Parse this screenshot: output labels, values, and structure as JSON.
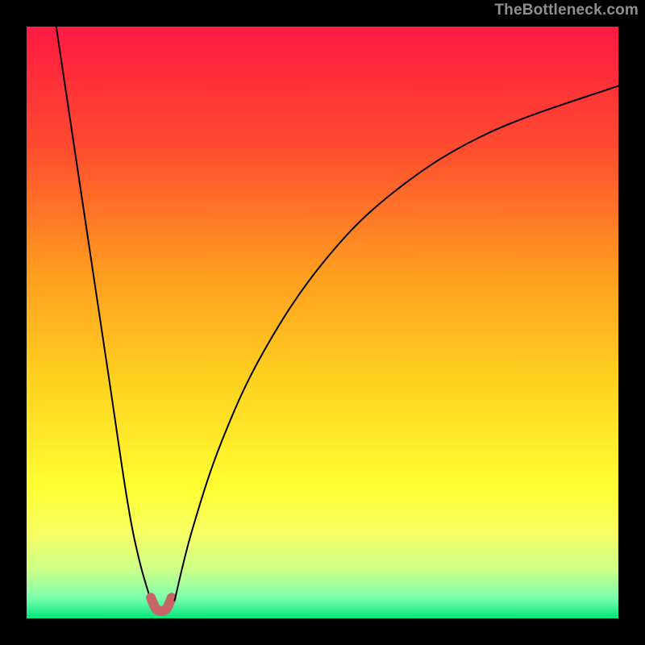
{
  "watermark": "TheBottleneck.com",
  "chart_data": {
    "type": "line",
    "title": "",
    "xlabel": "",
    "ylabel": "",
    "xlim": [
      0,
      100
    ],
    "ylim": [
      0,
      100
    ],
    "gradient_stops": [
      {
        "offset": 0,
        "color": "#ff1a42"
      },
      {
        "offset": 0.2,
        "color": "#ff4a2f"
      },
      {
        "offset": 0.42,
        "color": "#ff9e1f"
      },
      {
        "offset": 0.6,
        "color": "#ffd21f"
      },
      {
        "offset": 0.78,
        "color": "#ffff33"
      },
      {
        "offset": 0.86,
        "color": "#f6ff65"
      },
      {
        "offset": 0.92,
        "color": "#c9ff8a"
      },
      {
        "offset": 0.965,
        "color": "#7dffad"
      },
      {
        "offset": 1.0,
        "color": "#00e57a"
      }
    ],
    "good_zone_band": {
      "y_bottom": 0,
      "y_top": 3,
      "color": "#00e57a"
    },
    "series": [
      {
        "name": "left-branch",
        "type": "curve",
        "stroke": "#000000",
        "stroke_width": 2,
        "points": [
          {
            "x": 5,
            "y": 100
          },
          {
            "x": 8,
            "y": 80
          },
          {
            "x": 11,
            "y": 60
          },
          {
            "x": 14,
            "y": 40
          },
          {
            "x": 17,
            "y": 20
          },
          {
            "x": 19,
            "y": 10
          },
          {
            "x": 21,
            "y": 3
          }
        ]
      },
      {
        "name": "marker",
        "type": "marker",
        "stroke": "#c76566",
        "stroke_width": 12,
        "points": [
          {
            "x": 21.0,
            "y": 3.5
          },
          {
            "x": 22.0,
            "y": 1.5
          },
          {
            "x": 23.5,
            "y": 1.5
          },
          {
            "x": 24.5,
            "y": 3.5
          }
        ]
      },
      {
        "name": "right-branch",
        "type": "curve",
        "stroke": "#000000",
        "stroke_width": 2,
        "points": [
          {
            "x": 25,
            "y": 3
          },
          {
            "x": 28,
            "y": 15
          },
          {
            "x": 33,
            "y": 30
          },
          {
            "x": 40,
            "y": 45
          },
          {
            "x": 50,
            "y": 60
          },
          {
            "x": 62,
            "y": 72
          },
          {
            "x": 78,
            "y": 82
          },
          {
            "x": 100,
            "y": 90
          }
        ]
      }
    ]
  },
  "colors": {
    "frame": "#000000",
    "watermark": "#8f8f8f",
    "curve": "#000000",
    "marker": "#c76566"
  }
}
